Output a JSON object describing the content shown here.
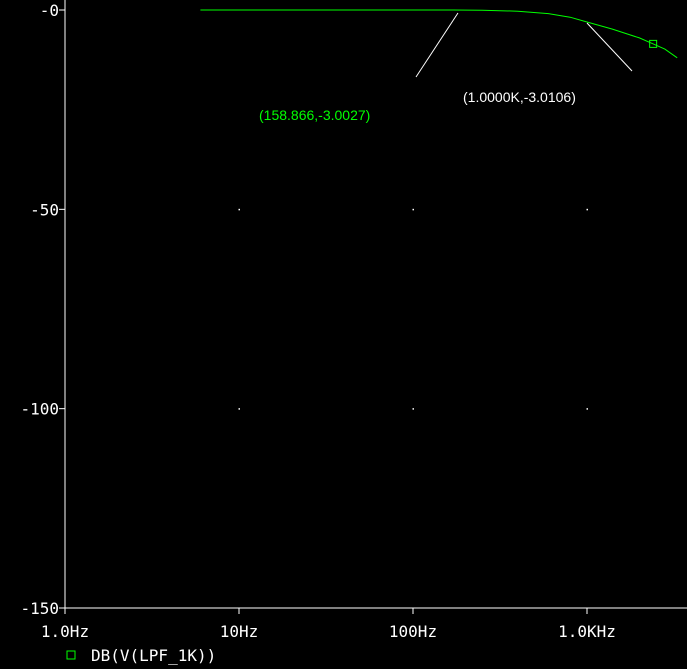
{
  "chart_data": {
    "type": "line",
    "x_scale": "log",
    "xlim": [
      1,
      3400
    ],
    "ylim": [
      -150,
      0
    ],
    "x_ticks": [
      {
        "value": 1,
        "label": "1.0Hz"
      },
      {
        "value": 10,
        "label": "10Hz"
      },
      {
        "value": 100,
        "label": "100Hz"
      },
      {
        "value": 1000,
        "label": "1.0KHz"
      }
    ],
    "y_ticks": [
      {
        "value": 0,
        "label": "-0"
      },
      {
        "value": -50,
        "label": "-50"
      },
      {
        "value": -100,
        "label": "-100"
      },
      {
        "value": -150,
        "label": "-150"
      }
    ],
    "grid": "dots",
    "series": [
      {
        "name": "DB(V(LPF_1K))",
        "color": "#00ff00",
        "marker": "square",
        "x": [
          6,
          30,
          80,
          170,
          250,
          400,
          600,
          800,
          1000,
          1400,
          2000,
          2400,
          2800,
          3300
        ],
        "y": [
          0,
          0,
          0,
          0,
          -0.05,
          -0.3,
          -0.9,
          -1.8,
          -3.0,
          -4.8,
          -7.0,
          -8.5,
          -9.8,
          -12.0
        ]
      }
    ],
    "annotations": [
      {
        "text": "(158.866,-3.0027)",
        "x": 158.866,
        "y": -3.0027,
        "color": "#00ff00"
      },
      {
        "text": "(1.0000K,-3.0106)",
        "x": 1000,
        "y": -3.0106,
        "color": "#ffffff"
      }
    ]
  },
  "legend": {
    "label": "DB(V(LPF_1K))",
    "marker_color": "#00ff00"
  }
}
